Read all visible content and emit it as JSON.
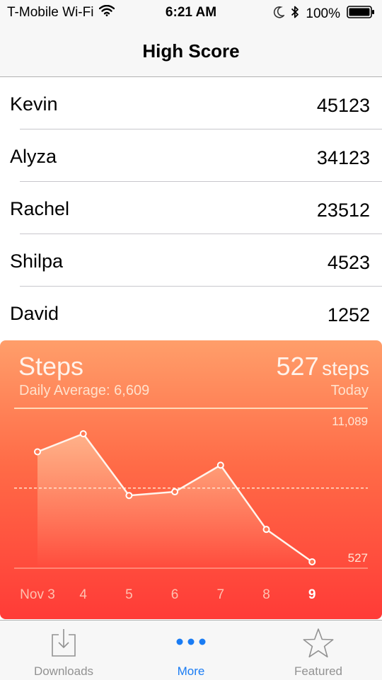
{
  "status_bar": {
    "carrier": "T-Mobile Wi-Fi",
    "time": "6:21 AM",
    "battery": "100%"
  },
  "nav": {
    "title": "High Score"
  },
  "scores": [
    {
      "name": "Kevin",
      "score": "45123"
    },
    {
      "name": "Alyza",
      "score": "34123"
    },
    {
      "name": "Rachel",
      "score": "23512"
    },
    {
      "name": "Shilpa",
      "score": "4523"
    },
    {
      "name": "David",
      "score": "1252"
    }
  ],
  "steps_card": {
    "title": "Steps",
    "daily_average": "Daily Average: 6,609",
    "count": "527",
    "count_unit": "steps",
    "period": "Today",
    "max_label": "11,089",
    "min_label": "527"
  },
  "chart_data": {
    "type": "area",
    "categories": [
      "Nov 3",
      "4",
      "5",
      "6",
      "7",
      "8",
      "9"
    ],
    "values": [
      9600,
      11089,
      6000,
      6300,
      8500,
      3200,
      527
    ],
    "average": 6609,
    "ylim": [
      0,
      11089
    ],
    "highlighted_category": "9",
    "grid": false
  },
  "tabs": [
    {
      "label": "Downloads",
      "icon": "downloads-icon",
      "active": false
    },
    {
      "label": "More",
      "icon": "more-icon",
      "active": true
    },
    {
      "label": "Featured",
      "icon": "star-icon",
      "active": false
    }
  ],
  "colors": {
    "accent": "#1a7cf4",
    "card_top": "#ff9e6a",
    "card_bottom": "#ff3b37"
  }
}
